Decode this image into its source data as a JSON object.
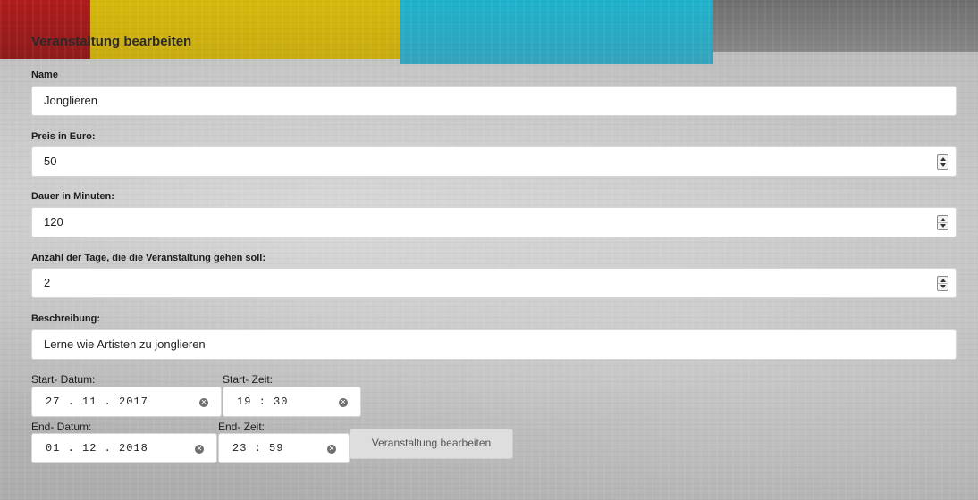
{
  "form": {
    "title": "Veranstaltung bearbeiten",
    "fields": {
      "name": {
        "label": "Name",
        "value": "Jonglieren"
      },
      "price": {
        "label": "Preis in Euro:",
        "value": "50"
      },
      "duration": {
        "label": "Dauer in Minuten:",
        "value": "120"
      },
      "days": {
        "label": "Anzahl der Tage, die die Veranstaltung gehen soll:",
        "value": "2"
      },
      "description": {
        "label": "Beschreibung:",
        "value": "Lerne wie Artisten zu jonglieren"
      }
    },
    "start_date": {
      "label": "Start- Datum:",
      "value": "27 . 11 . 2017"
    },
    "start_time": {
      "label": "Start- Zeit:",
      "value": "19 : 30"
    },
    "end_date": {
      "label": "End- Datum:",
      "value": "01 . 12 . 2018"
    },
    "end_time": {
      "label": "End- Zeit:",
      "value": "23 : 59"
    },
    "submit_label": "Veranstaltung bearbeiten"
  },
  "icons": {
    "clear": "clear-circle-icon",
    "spinner": "number-spinner-icon"
  },
  "colors": {
    "red": "#b01c1c",
    "yellow": "#d6b90d",
    "cyan": "#1fb2cc",
    "gray": "#6f6f6f"
  }
}
